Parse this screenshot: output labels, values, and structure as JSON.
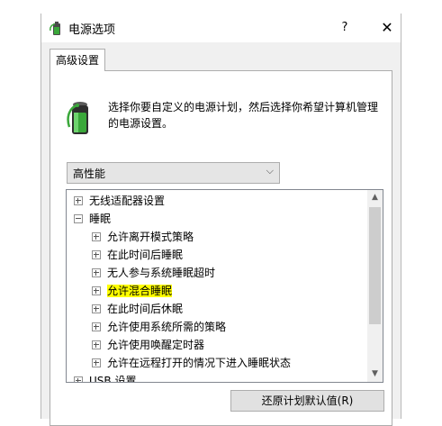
{
  "window": {
    "title": "电源选项",
    "help_label": "?",
    "close_label": "✕"
  },
  "tab": {
    "label": "高级设置"
  },
  "description": "选择你要自定义的电源计划，然后选择你希望计算机管理的电源设置。",
  "plan_select": {
    "value": "高性能",
    "arrow": "⌵"
  },
  "tree": {
    "items": [
      {
        "label": "无线适配器设置",
        "expander": "plus",
        "level": 0,
        "highlighted": false
      },
      {
        "label": "睡眠",
        "expander": "minus",
        "level": 0,
        "highlighted": false
      },
      {
        "label": "允许离开模式策略",
        "expander": "plus",
        "level": 1,
        "highlighted": false
      },
      {
        "label": "在此时间后睡眠",
        "expander": "plus",
        "level": 1,
        "highlighted": false
      },
      {
        "label": "无人参与系统睡眠超时",
        "expander": "plus",
        "level": 1,
        "highlighted": false
      },
      {
        "label": "允许混合睡眠",
        "expander": "plus",
        "level": 1,
        "highlighted": true
      },
      {
        "label": "在此时间后休眠",
        "expander": "plus",
        "level": 1,
        "highlighted": false
      },
      {
        "label": "允许使用系统所需的策略",
        "expander": "plus",
        "level": 1,
        "highlighted": false
      },
      {
        "label": "允许使用唤醒定时器",
        "expander": "plus",
        "level": 1,
        "highlighted": false
      },
      {
        "label": "允许在远程打开的情况下进入睡眠状态",
        "expander": "plus",
        "level": 1,
        "highlighted": false
      },
      {
        "label": "USB 设置",
        "expander": "plus",
        "level": 0,
        "highlighted": false
      }
    ],
    "scroll_up": "▲",
    "scroll_down": "▼"
  },
  "restore_button": {
    "label": "还原计划默认值(R)"
  },
  "colors": {
    "highlight": "#ffff00",
    "battery_green": "#3aa83a"
  }
}
